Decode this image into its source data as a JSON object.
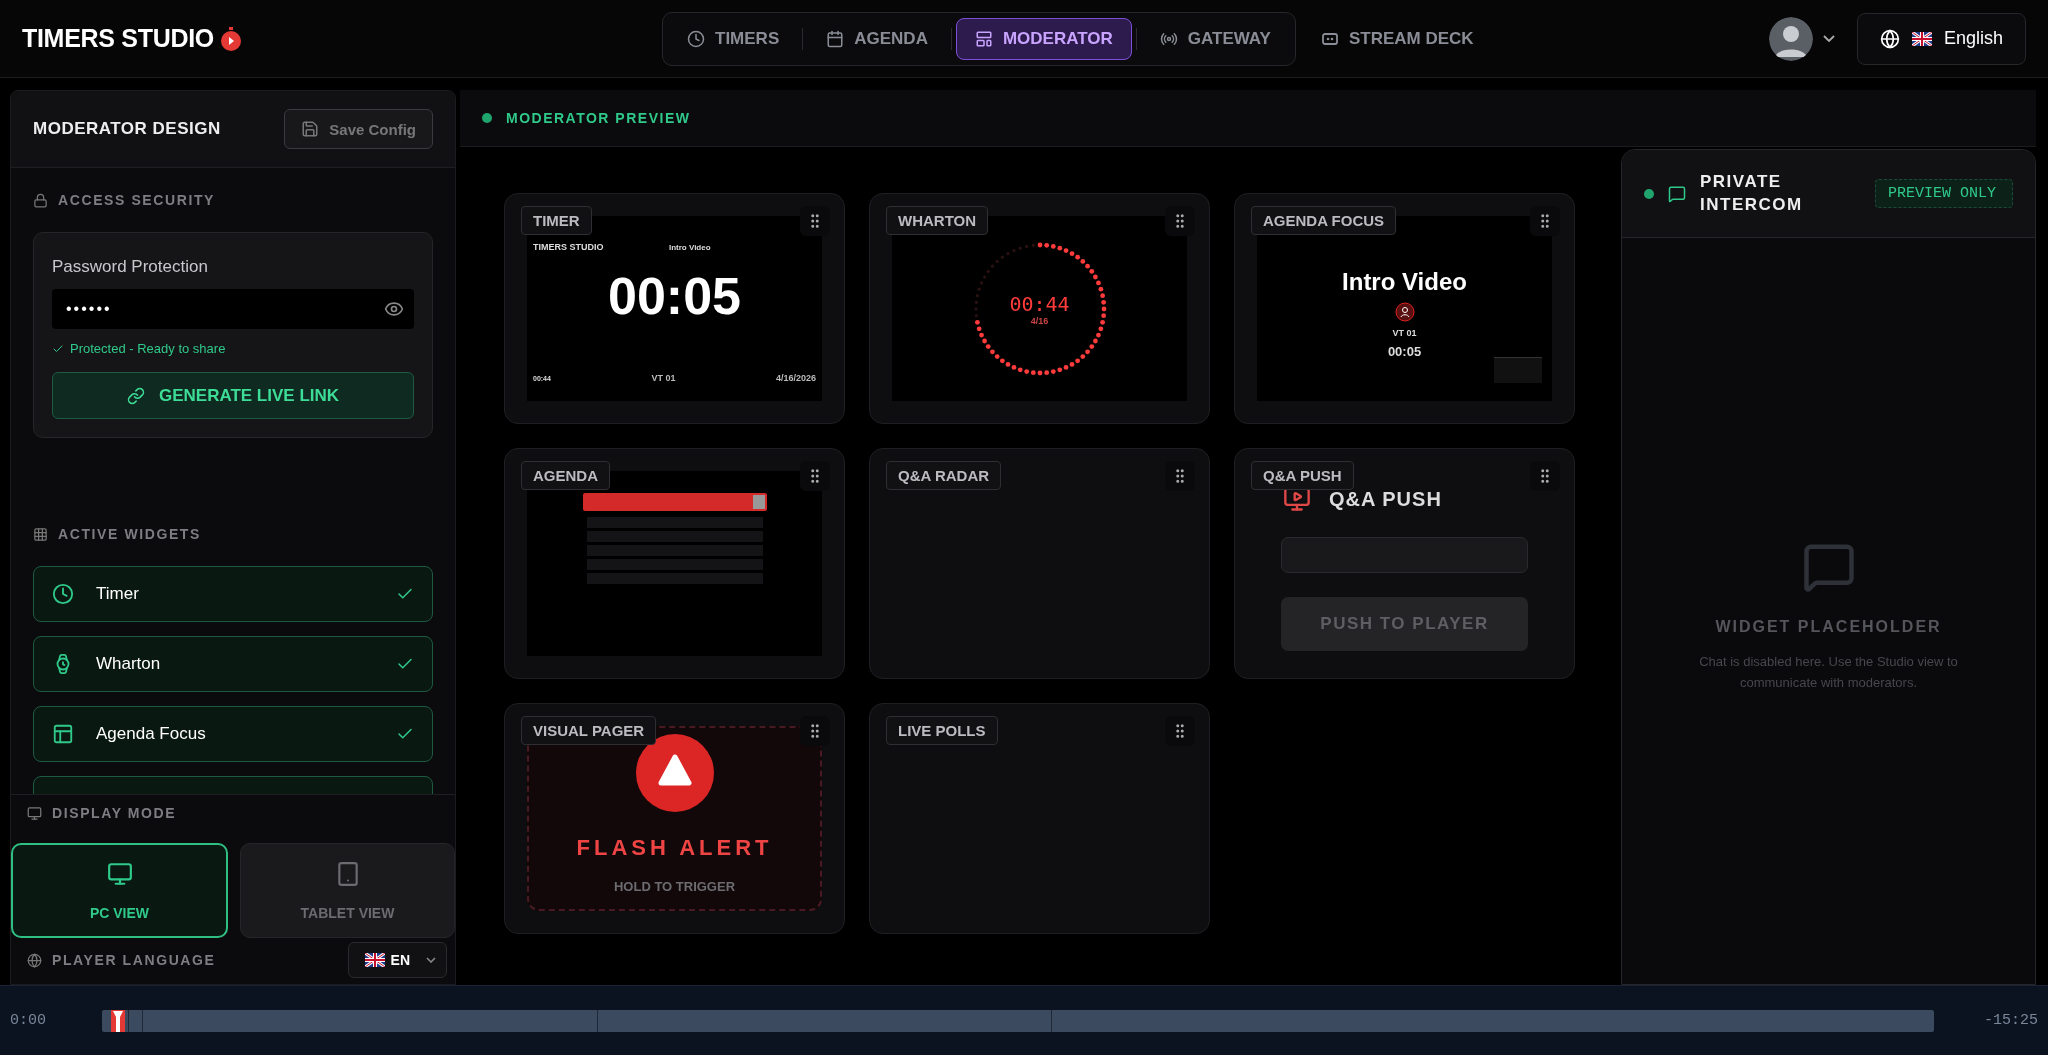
{
  "header": {
    "logo": "TIMERS STUDIO",
    "nav": [
      {
        "label": "TIMERS",
        "kind": "timers",
        "selected": false
      },
      {
        "label": "AGENDA",
        "kind": "agenda",
        "selected": false
      },
      {
        "label": "MODERATOR",
        "kind": "moderator",
        "selected": true
      },
      {
        "label": "GATEWAY",
        "kind": "gateway",
        "selected": false
      },
      {
        "label": "STREAM DECK",
        "kind": "deck",
        "selected": false
      }
    ],
    "language": "English"
  },
  "design": {
    "title": "MODERATOR DESIGN",
    "save_button": "Save Config",
    "security": {
      "heading": "ACCESS SECURITY",
      "label": "Password Protection",
      "value": "••••••",
      "status": "Protected - Ready to share",
      "button": "GENERATE LIVE LINK"
    },
    "widgets_heading": "ACTIVE WIDGETS",
    "widgets": [
      {
        "label": "Timer",
        "kind": "clock",
        "checked": true
      },
      {
        "label": "Wharton",
        "kind": "watch",
        "checked": true
      },
      {
        "label": "Agenda Focus",
        "kind": "layout",
        "checked": true
      }
    ],
    "display_heading": "DISPLAY MODE",
    "display_modes": [
      {
        "label": "PC VIEW",
        "kind": "pc",
        "selected": true
      },
      {
        "label": "TABLET VIEW",
        "kind": "tablet",
        "selected": false
      }
    ],
    "language_heading": "PLAYER LANGUAGE",
    "language": "EN"
  },
  "preview": {
    "title": "MODERATOR PREVIEW",
    "widgets": [
      {
        "title": "TIMER",
        "kind": "timer",
        "brand": "TIMERS STUDIO",
        "event": "Intro Video",
        "time": "00:05",
        "elapsed": "00:44",
        "cue": "VT 01",
        "date": "4/16/2026"
      },
      {
        "title": "WHARTON",
        "kind": "wharton",
        "time": "00:44",
        "count": "4/16"
      },
      {
        "title": "AGENDA FOCUS",
        "kind": "agenda_focus",
        "event": "Intro Video",
        "cue": "VT 01",
        "time": "00:05"
      },
      {
        "title": "AGENDA",
        "kind": "agenda"
      },
      {
        "title": "Q&A RADAR",
        "kind": "empty"
      },
      {
        "title": "Q&A PUSH",
        "kind": "qa_push",
        "heading": "Q&A PUSH",
        "button": "PUSH TO PLAYER"
      },
      {
        "title": "VISUAL PAGER",
        "kind": "pager",
        "alert": "FLASH ALERT",
        "hint": "HOLD TO TRIGGER"
      },
      {
        "title": "LIVE POLLS",
        "kind": "empty"
      }
    ]
  },
  "intercom": {
    "title": "PRIVATE INTERCOM",
    "badge": "PREVIEW ONLY",
    "placeholder_title": "WIDGET PLACEHOLDER",
    "placeholder_text": "Chat is disabled here. Use the Studio view to communicate with moderators."
  },
  "timeline": {
    "start": "0:00",
    "end": "-15:25",
    "level": 0.005
  }
}
